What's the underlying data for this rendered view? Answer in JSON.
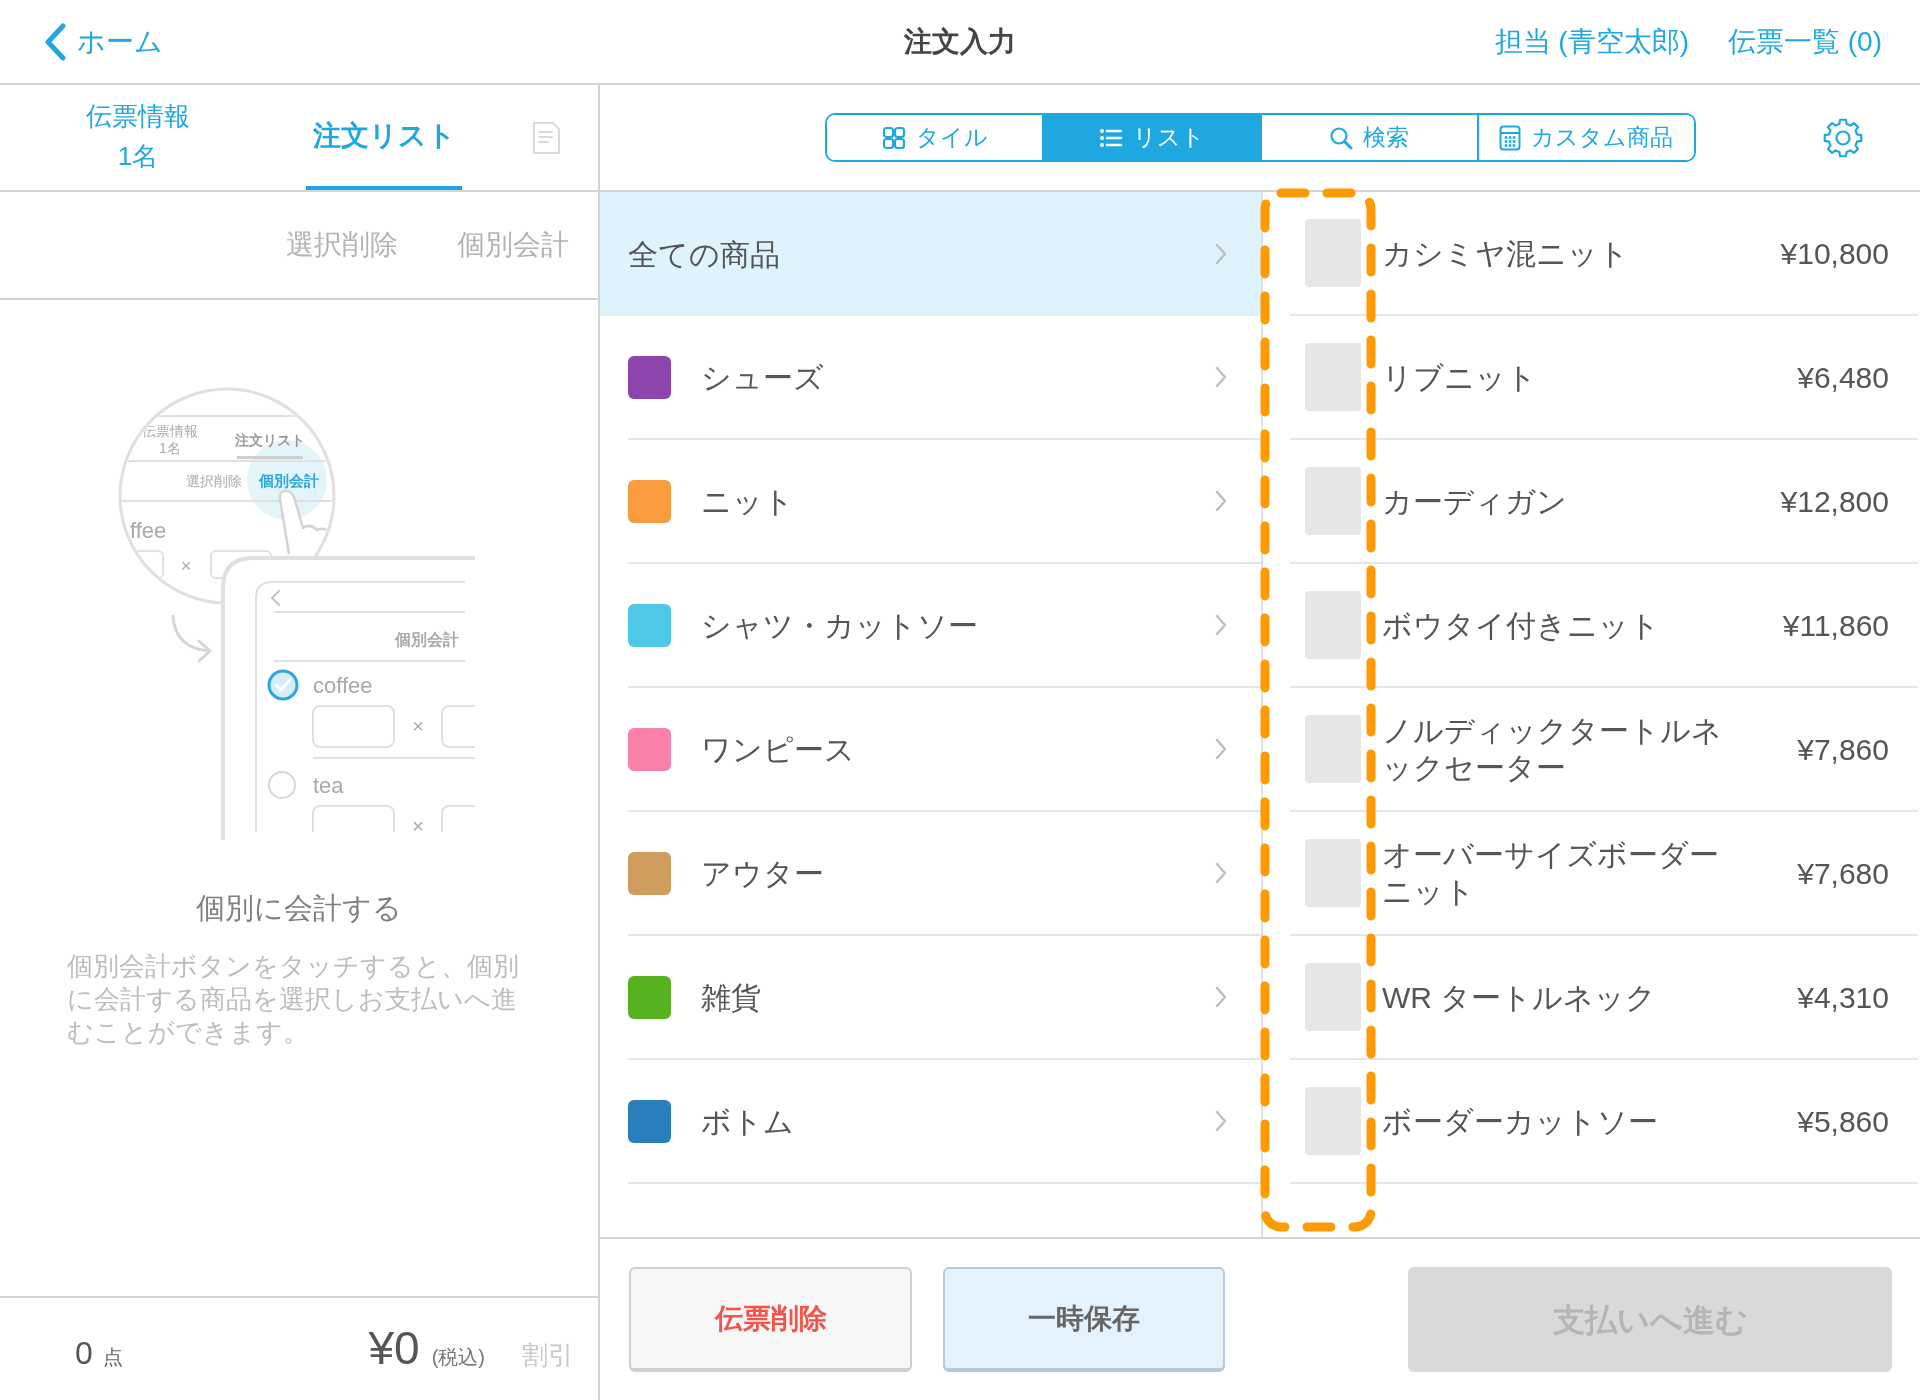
{
  "header": {
    "back_label": "ホーム",
    "title": "注文入力",
    "links": [
      "担当 (青空太郎)",
      "伝票一覧 (0)"
    ]
  },
  "left_tabs": [
    {
      "label": "伝票情報",
      "sub": "1名",
      "selected": false
    },
    {
      "label": "注文リスト",
      "selected": true
    }
  ],
  "receipt_tab": {
    "disabled": true
  },
  "order_actions": [
    {
      "label": "選択削除",
      "disabled": true
    },
    {
      "label": "個別会計",
      "disabled": true
    }
  ],
  "illustration": {
    "magnifier": {
      "tabs": [
        {
          "label": "伝票情報",
          "sub": "1名",
          "selected": false
        },
        {
          "label": "注文リスト",
          "selected": true
        }
      ],
      "actions": [
        {
          "label": "選択削除",
          "highlighted": false
        },
        {
          "label": "個別会計",
          "highlighted": true
        }
      ],
      "item": "ffee",
      "times": "×"
    },
    "tablet": {
      "action": "個別会計",
      "items": [
        {
          "name": "coffee",
          "checked": true,
          "times": "×"
        },
        {
          "name": "tea",
          "checked": false,
          "times": "×"
        }
      ]
    }
  },
  "empty_state": {
    "title": "個別に会計する",
    "description": "個別会計ボタンをタッチすると、個別に会計する商品を選択しお支払いへ進むことができます。"
  },
  "summary": {
    "count": "0",
    "count_unit": "点",
    "total": "¥0",
    "tax_note": "(税込)",
    "discount": {
      "label": "割引",
      "disabled": true
    }
  },
  "view_modes": [
    {
      "kind": "tiles",
      "label": "タイル",
      "selected": false
    },
    {
      "kind": "list",
      "label": "リスト",
      "selected": true
    },
    {
      "kind": "search",
      "label": "検索",
      "selected": false
    },
    {
      "kind": "calculator",
      "label": "カスタム商品",
      "selected": false
    }
  ],
  "categories": [
    {
      "label": "全ての商品",
      "selected": true
    },
    {
      "label": "シューズ",
      "color": "#8e44ad",
      "selected": false
    },
    {
      "label": "ニット",
      "color": "#f99b3e",
      "selected": false
    },
    {
      "label": "シャツ・カットソー",
      "color": "#4dc8e6",
      "selected": false
    },
    {
      "label": "ワンピース",
      "color": "#f880ab",
      "selected": false
    },
    {
      "label": "アウター",
      "color": "#cf9e5f",
      "selected": false
    },
    {
      "label": "雑貨",
      "color": "#58b21f",
      "selected": false
    },
    {
      "label": "ボトム",
      "color": "#2a7fba",
      "selected": false
    }
  ],
  "products": [
    {
      "name": "カシミヤ混ニット",
      "price": "¥10,800"
    },
    {
      "name": "リブニット",
      "price": "¥6,480"
    },
    {
      "name": "カーディガン",
      "price": "¥12,800"
    },
    {
      "name": "ボウタイ付きニット",
      "price": "¥11,860"
    },
    {
      "name": "ノルディックタートルネックセーター",
      "price": "¥7,860"
    },
    {
      "name": "オーバーサイズボーダーニット",
      "price": "¥7,680"
    },
    {
      "name": "WR タートルネック",
      "price": "¥4,310"
    },
    {
      "name": "ボーダーカットソー",
      "price": "¥5,860"
    }
  ],
  "bottom_buttons": [
    {
      "kind": "delete",
      "label": "伝票削除",
      "disabled": false
    },
    {
      "kind": "save",
      "label": "一時保存",
      "disabled": false
    },
    {
      "kind": "pay",
      "label": "支払いへ進む",
      "disabled": true
    }
  ]
}
